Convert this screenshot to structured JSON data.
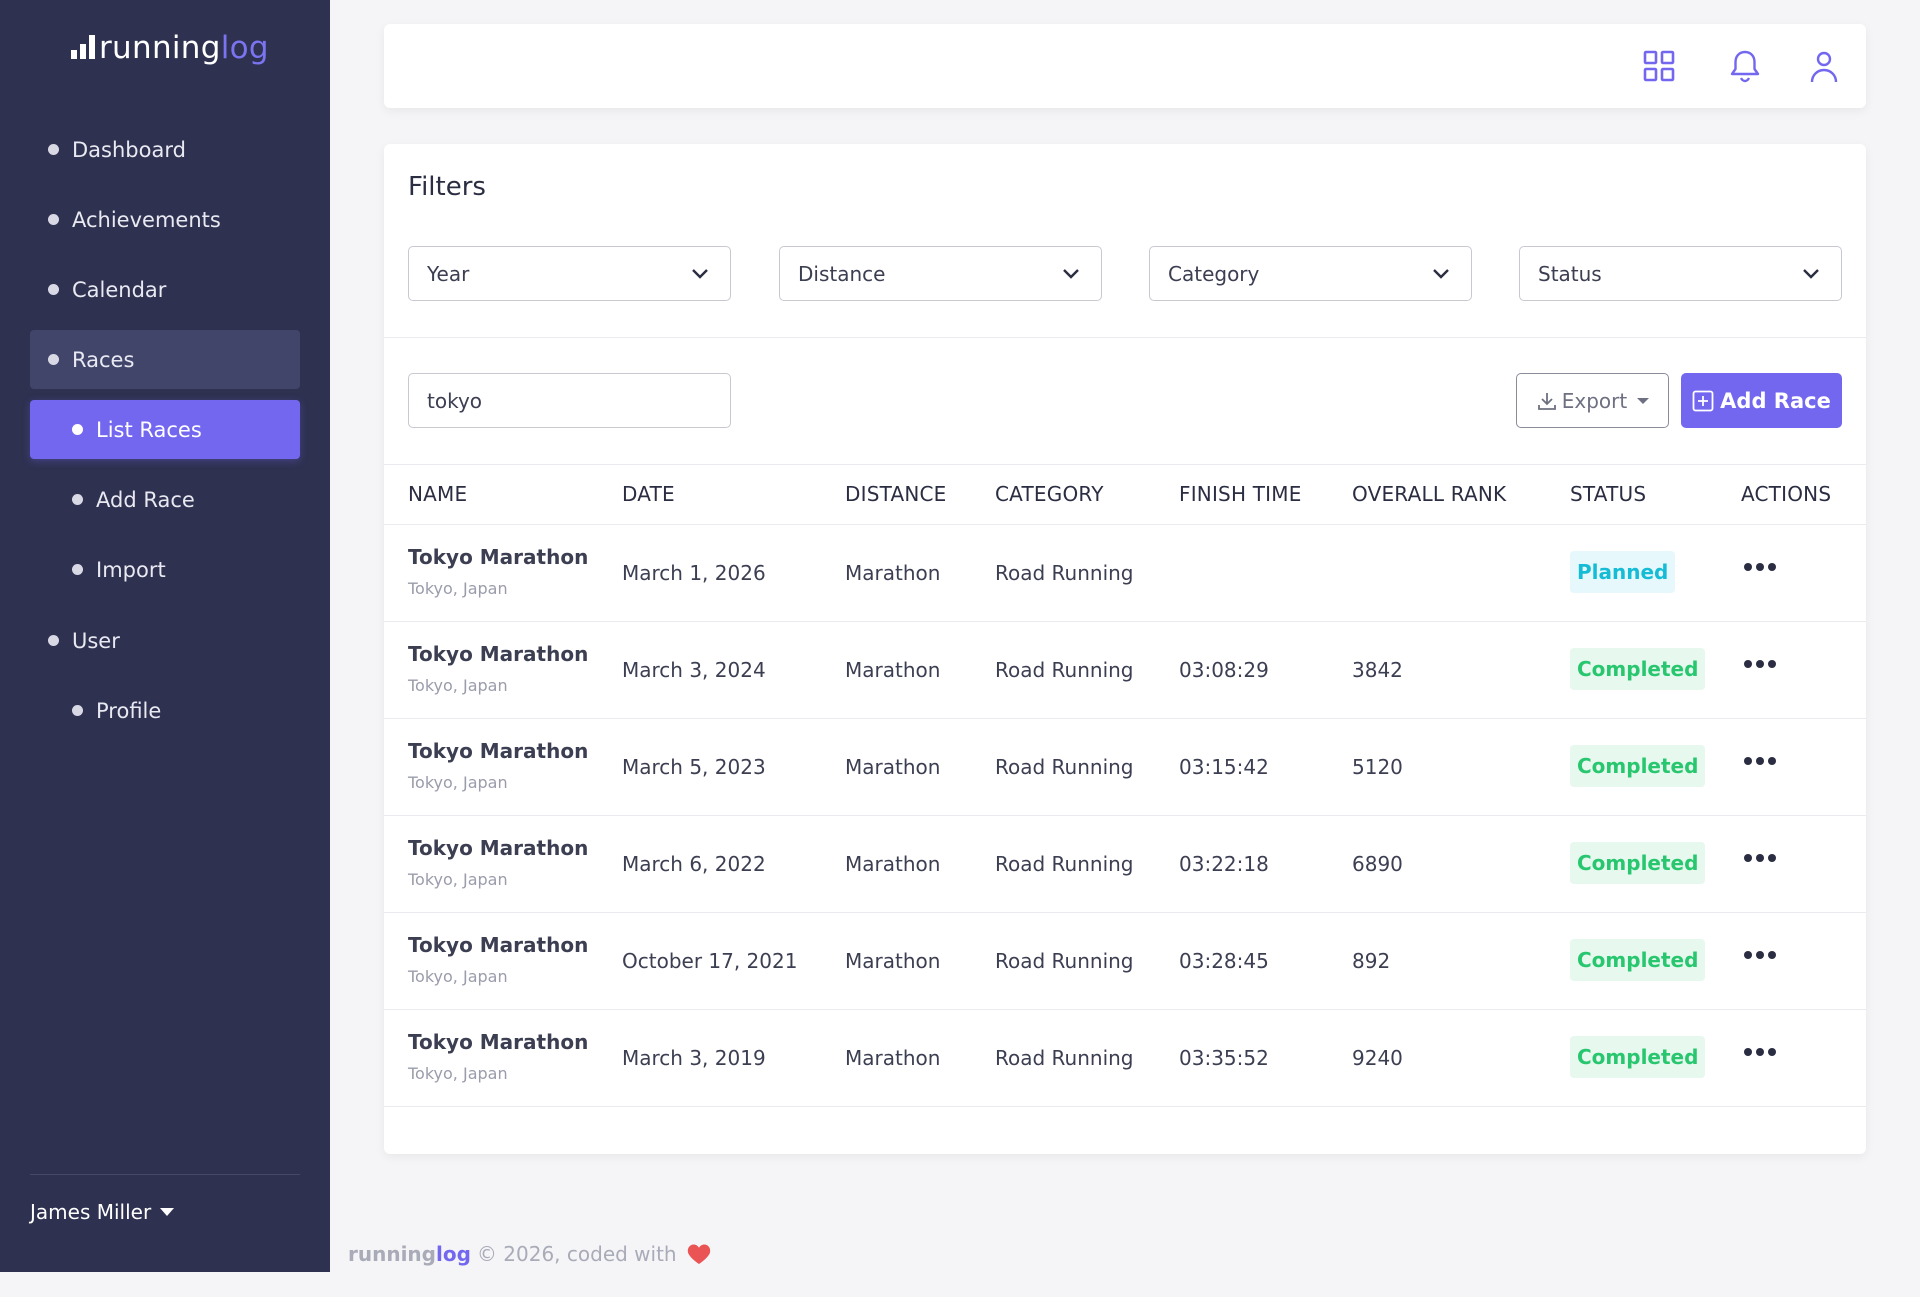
{
  "brand": {
    "part1": "running",
    "part2": "log"
  },
  "sidebar": {
    "items": [
      {
        "label": "Dashboard"
      },
      {
        "label": "Achievements"
      },
      {
        "label": "Calendar"
      },
      {
        "label": "Races"
      },
      {
        "label": "List Races"
      },
      {
        "label": "Add Race"
      },
      {
        "label": "Import"
      },
      {
        "label": "User"
      },
      {
        "label": "Profile"
      }
    ],
    "user_name": "James Miller"
  },
  "topbar": {
    "icons": [
      "apps-grid-icon",
      "bell-icon",
      "user-icon"
    ]
  },
  "filters": {
    "title": "Filters",
    "selects": [
      {
        "value": "Year"
      },
      {
        "value": "Distance"
      },
      {
        "value": "Category"
      },
      {
        "value": "Status"
      }
    ]
  },
  "toolbar": {
    "search_value": "tokyo",
    "export_label": "Export",
    "add_label": "Add Race"
  },
  "table": {
    "headers": [
      "NAME",
      "DATE",
      "DISTANCE",
      "CATEGORY",
      "FINISH TIME",
      "OVERALL RANK",
      "STATUS",
      "ACTIONS"
    ],
    "rows": [
      {
        "name": "Tokyo Marathon",
        "location": "Tokyo, Japan",
        "date": "March 1, 2026",
        "distance": "Marathon",
        "category": "Road Running",
        "finish_time": "",
        "rank": "",
        "status": "Planned"
      },
      {
        "name": "Tokyo Marathon",
        "location": "Tokyo, Japan",
        "date": "March 3, 2024",
        "distance": "Marathon",
        "category": "Road Running",
        "finish_time": "03:08:29",
        "rank": "3842",
        "status": "Completed"
      },
      {
        "name": "Tokyo Marathon",
        "location": "Tokyo, Japan",
        "date": "March 5, 2023",
        "distance": "Marathon",
        "category": "Road Running",
        "finish_time": "03:15:42",
        "rank": "5120",
        "status": "Completed"
      },
      {
        "name": "Tokyo Marathon",
        "location": "Tokyo, Japan",
        "date": "March 6, 2022",
        "distance": "Marathon",
        "category": "Road Running",
        "finish_time": "03:22:18",
        "rank": "6890",
        "status": "Completed"
      },
      {
        "name": "Tokyo Marathon",
        "location": "Tokyo, Japan",
        "date": "October 17, 2021",
        "distance": "Marathon",
        "category": "Road Running",
        "finish_time": "03:28:45",
        "rank": "892",
        "status": "Completed"
      },
      {
        "name": "Tokyo Marathon",
        "location": "Tokyo, Japan",
        "date": "March 3, 2019",
        "distance": "Marathon",
        "category": "Road Running",
        "finish_time": "03:35:52",
        "rank": "9240",
        "status": "Completed"
      }
    ]
  },
  "footer": {
    "brand_part1": "running",
    "brand_part2": "log",
    "text": "© 2026, coded with"
  },
  "colors": {
    "sidebar_bg": "#2e3150",
    "accent": "#7367f0",
    "planned": "#16bcd6",
    "completed": "#28c76f",
    "heart": "#ea5455"
  }
}
